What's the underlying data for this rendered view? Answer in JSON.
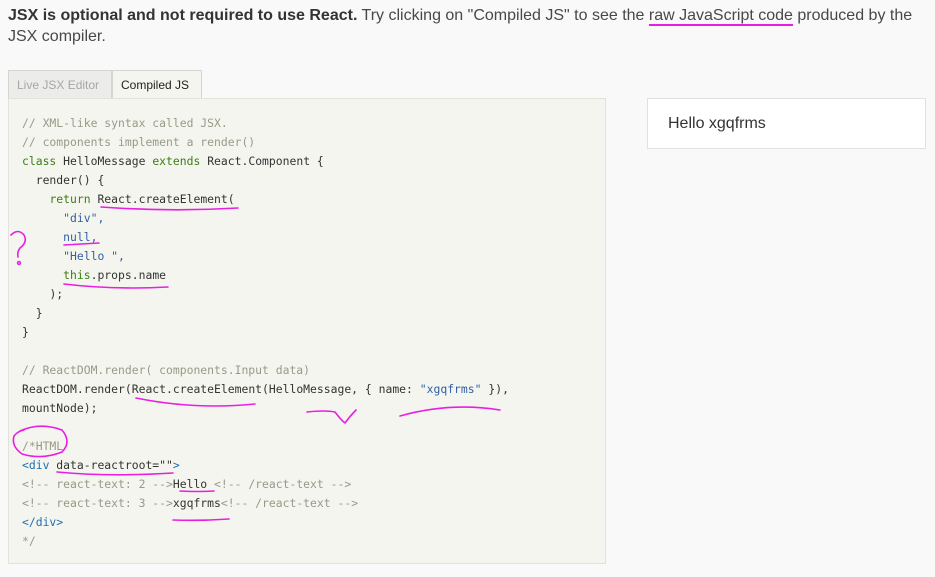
{
  "intro": {
    "bold": "JSX is optional and not required to use React.",
    "text_before": " Try clicking on \"Compiled JS\" to see the ",
    "link": "raw JavaScript code",
    "text_after": " produced by the JSX compiler."
  },
  "tabs": [
    {
      "label": "Live JSX Editor",
      "active": false
    },
    {
      "label": "Compiled JS",
      "active": true
    }
  ],
  "code": {
    "comment1": "// XML-like syntax called JSX.",
    "comment2": "// components implement a render()",
    "class_kw": "class",
    "class_name": "HelloMessage",
    "extends_kw": "extends",
    "extends_name": "React.Component {",
    "render_sig": "render() {",
    "return_kw": "return",
    "create_element": "React.createElement(",
    "arg_div": "\"div\",",
    "arg_null": "null,",
    "arg_hello": "\"Hello \",",
    "this_kw": "this",
    "props_name": ".props.name",
    "close_paren": ");",
    "close_brace_inner": "}",
    "close_brace_outer": "}",
    "comment3": "// ReactDOM.render( components.Input data)",
    "render_call_prefix": "ReactDOM.render(",
    "render_call_create": "React.createElement(HelloMessage, { name: ",
    "render_call_string": "\"xgqfrms\"",
    "render_call_suffix": " }),",
    "mount_node": "mountNode);",
    "html_comment_open": "/*HTML",
    "div_open_tag": "<div ",
    "div_attr": "data-reactroot=\"\"",
    "div_open_end": ">",
    "rt2_open": "<!-- react-text: 2 -->",
    "rt2_text": "Hello",
    "rt2_close": " <!-- /react-text -->",
    "rt3_open": "<!-- react-text: 3 -->",
    "rt3_text": "xgqfrms",
    "rt3_close": "<!-- /react-text -->",
    "div_close_tag": "</div>",
    "html_comment_close": "*/"
  },
  "output": {
    "text": "Hello xgqfrms"
  },
  "annotation_color": "#e91ee2"
}
